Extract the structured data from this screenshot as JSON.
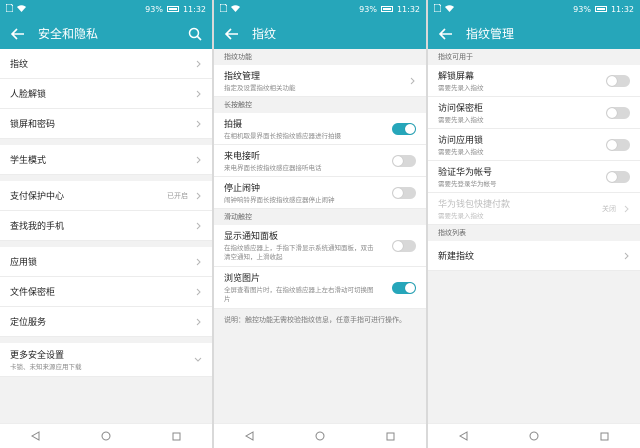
{
  "status": {
    "battery": "93%",
    "time": "11:32"
  },
  "screen1": {
    "title": "安全和隐私",
    "rows": [
      {
        "label": "指纹",
        "group": 1
      },
      {
        "label": "人脸解锁",
        "group": 1
      },
      {
        "label": "锁屏和密码",
        "group": 1
      },
      {
        "label": "学生模式",
        "group": 2
      },
      {
        "label": "支付保护中心",
        "value": "已开启",
        "group": 3
      },
      {
        "label": "查找我的手机",
        "group": 3
      },
      {
        "label": "应用锁",
        "group": 4
      },
      {
        "label": "文件保密柜",
        "group": 4
      },
      {
        "label": "定位服务",
        "group": 4
      },
      {
        "label": "更多安全设置",
        "sub": "卡锁、未知来源应用下载",
        "group": 5
      }
    ]
  },
  "screen2": {
    "title": "指纹",
    "section_fingerprint": "指纹功能",
    "manage": {
      "label": "指纹管理",
      "sub": "指定及设置指纹相关功能"
    },
    "section_longpress": "长按触控",
    "photo": {
      "label": "拍摄",
      "sub": "在相机取景界面长按指纹感应器进行拍摄",
      "on": true
    },
    "call": {
      "label": "来电接听",
      "sub": "来电界面长按指纹感应器接听电话",
      "on": false
    },
    "alarm": {
      "label": "停止闹钟",
      "sub": "闹钟响铃界面长按指纹感应器停止闹钟",
      "on": false
    },
    "section_swipe": "滑动触控",
    "notify": {
      "label": "显示通知面板",
      "sub": "在指纹感应器上，手指下滑显示系统通知面板，双击清空通知，上滑收起",
      "on": false
    },
    "browse": {
      "label": "浏览图片",
      "sub": "全屏查看图片时，在指纹感应器上左右滑动可切换图片",
      "on": true
    },
    "note": "说明：触控功能无需校验指纹信息，任意手指可进行操作。"
  },
  "screen3": {
    "title": "指纹管理",
    "section_usable": "指纹可用于",
    "unlock": {
      "label": "解锁屏幕",
      "sub": "需要先录入指纹",
      "on": false
    },
    "vault": {
      "label": "访问保密柜",
      "sub": "需要先录入指纹",
      "on": false
    },
    "applock": {
      "label": "访问应用锁",
      "sub": "需要先录入指纹",
      "on": false
    },
    "huawei": {
      "label": "验证华为帐号",
      "sub": "需要先登录华为帐号",
      "on": false
    },
    "wallet": {
      "label": "华为钱包快捷付款",
      "sub": "需要先录入指纹",
      "value": "关闭"
    },
    "section_list": "指纹列表",
    "new": {
      "label": "新建指纹"
    }
  }
}
